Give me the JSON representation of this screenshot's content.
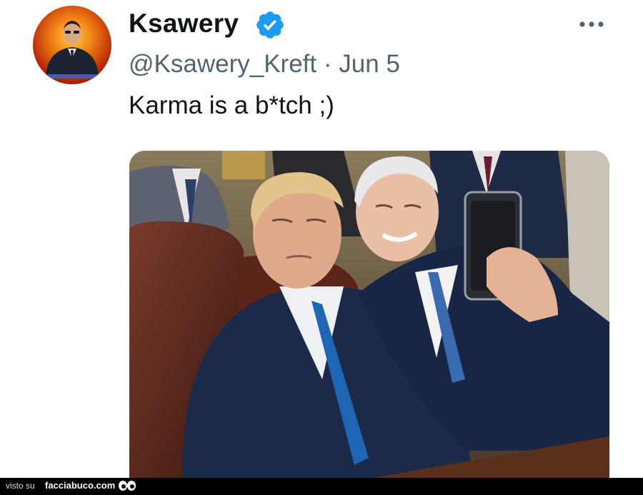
{
  "tweet": {
    "display_name": "Ksawery",
    "verified_icon": "verified-badge-icon",
    "handle": "@Ksawery_Kreft",
    "separator": "·",
    "date": "Jun 5",
    "text": "Karma is a b*tch ;)",
    "more_icon": "more-options-icon",
    "avatar_icon": "profile-avatar",
    "media_icon": "tweet-photo"
  },
  "footer": {
    "visto_label": "visto su",
    "site_label": "facciabuco.com",
    "eyes_icon": "eyes-logo-icon"
  },
  "colors": {
    "verified_blue": "#1d9bf0",
    "text_primary": "#0f1419",
    "text_secondary": "#536471",
    "footer_bg": "#000000"
  }
}
